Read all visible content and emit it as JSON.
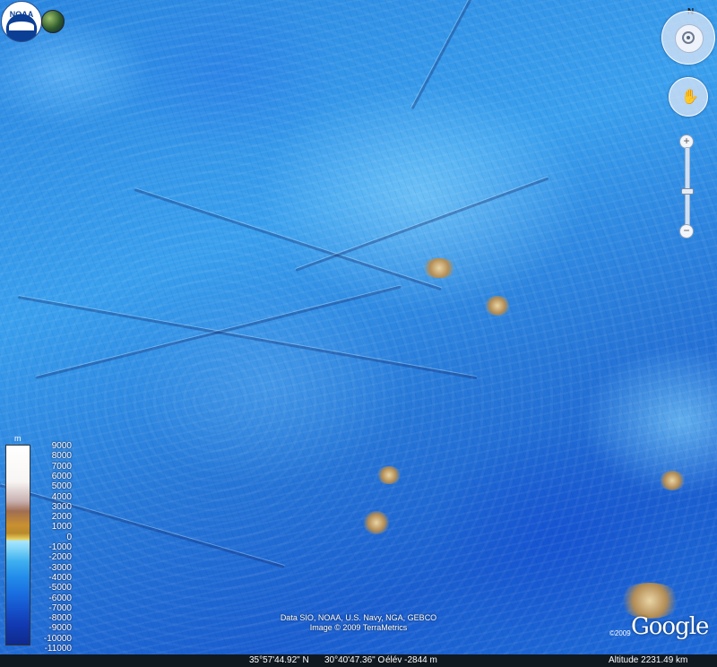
{
  "app": {
    "logo_text": "NOAA"
  },
  "navigation": {
    "north_label": "N",
    "zoom_in_label": "+",
    "zoom_out_label": "−",
    "zoom_level": 0.55
  },
  "legend": {
    "unit": "m",
    "ticks": [
      "9000",
      "8000",
      "7000",
      "6000",
      "5000",
      "4000",
      "3000",
      "2000",
      "1000",
      "0",
      "-1000",
      "-2000",
      "-3000",
      "-4000",
      "-5000",
      "-6000",
      "-7000",
      "-8000",
      "-9000",
      "-10000",
      "-11000"
    ]
  },
  "attribution": {
    "data_credit": "Data SIO, NOAA, U.S. Navy, NGA, GEBCO",
    "image_credit": "Image © 2009 TerraMetrics",
    "google_year": "©2009",
    "google_logo": "Google"
  },
  "status_bar": {
    "latitude": "35°57'44.92\" N",
    "longitude": "30°40'47.36\" O",
    "elevation": "élév  -2844 m",
    "altitude": "Altitude  2231.49 km"
  },
  "colors": {
    "ocean_deep": "#1553cc",
    "ocean_shallow": "#3fb0f0",
    "land": "#b48d55"
  },
  "icons": [
    "noaa-logo",
    "globe-icon",
    "look-control-icon",
    "move-control-icon",
    "zoom-in-icon",
    "zoom-out-icon"
  ]
}
